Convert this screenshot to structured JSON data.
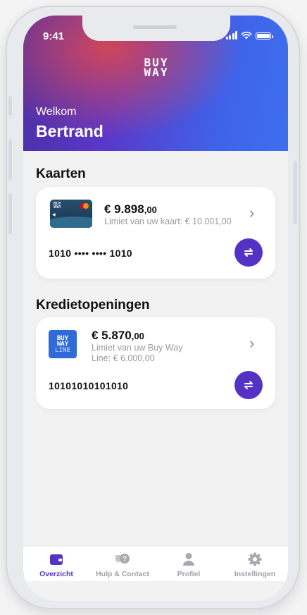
{
  "status_bar": {
    "time": "9:41"
  },
  "header": {
    "logo_line1": "BUY",
    "logo_line2": "WAY",
    "welcome": "Welkom",
    "user_name": "Bertrand"
  },
  "cards_section": {
    "title": "Kaarten",
    "card": {
      "amount_main": "€ 9.898",
      "amount_cents": ",00",
      "limit_text": "Limiet van uw kaart: € 10.001,00",
      "number": "1010 •••• •••• 1010",
      "card_logo_line1": "BUY",
      "card_logo_line2": "WAY"
    }
  },
  "credit_section": {
    "title": "Kredietopeningen",
    "card": {
      "tile_line1": "BUY",
      "tile_line2": "WAY",
      "tile_line3": "LINE",
      "amount_main": "€ 5.870",
      "amount_cents": ",00",
      "limit_line1": "Limiet van uw Buy Way",
      "limit_line2": "Line: € 6.000,00",
      "number": "10101010101010"
    }
  },
  "tabbar": {
    "tabs": [
      {
        "label": "Overzicht",
        "icon": "wallet-icon",
        "active": true
      },
      {
        "label": "Hulp & Contact",
        "icon": "help-chat-icon",
        "active": false
      },
      {
        "label": "Profiel",
        "icon": "profile-icon",
        "active": false
      },
      {
        "label": "Instellingen",
        "icon": "gear-icon",
        "active": false
      }
    ]
  },
  "colors": {
    "accent": "#5433c4",
    "header_gradient_start": "#4b2fa3",
    "header_gradient_end": "#3d6ff0",
    "header_glow": "#d64654",
    "tile_blue": "#2f6bd6"
  }
}
